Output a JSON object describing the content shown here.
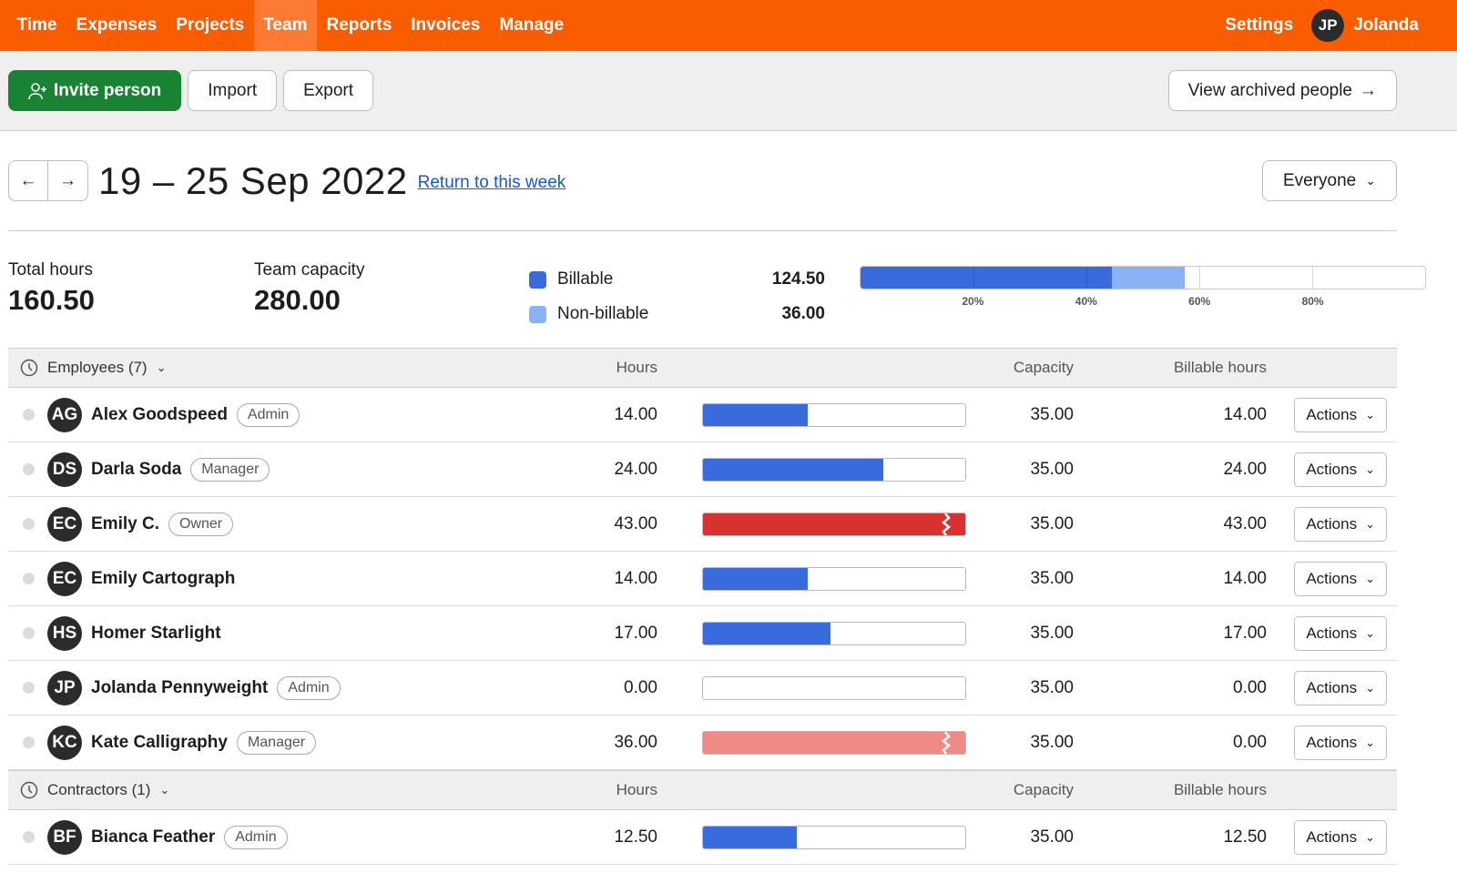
{
  "nav": {
    "items": [
      {
        "label": "Time",
        "active": false
      },
      {
        "label": "Expenses",
        "active": false
      },
      {
        "label": "Projects",
        "active": false
      },
      {
        "label": "Team",
        "active": true
      },
      {
        "label": "Reports",
        "active": false
      },
      {
        "label": "Invoices",
        "active": false
      },
      {
        "label": "Manage",
        "active": false
      }
    ],
    "settings": "Settings",
    "user_initials": "JP",
    "user_name": "Jolanda"
  },
  "toolbar": {
    "invite": "Invite person",
    "import": "Import",
    "export": "Export",
    "archived": "View archived people"
  },
  "week": {
    "title": "19 – 25 Sep 2022",
    "return_link": "Return to this week",
    "filter": "Everyone"
  },
  "summary": {
    "total_label": "Total hours",
    "total_value": "160.50",
    "capacity_label": "Team capacity",
    "capacity_value": "280.00",
    "billable_label": "Billable",
    "billable_value": "124.50",
    "nonbillable_label": "Non-billable",
    "nonbillable_value": "36.00",
    "billable_pct": 44.5,
    "nonbillable_pct": 12.9,
    "ticks": [
      "20%",
      "40%",
      "60%",
      "80%"
    ]
  },
  "colors": {
    "brand": "#fa5d00",
    "billable": "#3a6bdc",
    "nonbillable": "#8ab3f5",
    "over": "#d93030",
    "over_light": "#f08a84",
    "invite": "#188433"
  },
  "columns": {
    "hours": "Hours",
    "capacity": "Capacity",
    "billable": "Billable hours"
  },
  "actions_label": "Actions",
  "groups": [
    {
      "label": "Employees (7)",
      "people": [
        {
          "initials": "AG",
          "name": "Alex Goodspeed",
          "role": "Admin",
          "hours": "14.00",
          "capacity": "35.00",
          "billable": "14.00",
          "fill_pct": 40,
          "kind": "billable"
        },
        {
          "initials": "DS",
          "name": "Darla Soda",
          "role": "Manager",
          "hours": "24.00",
          "capacity": "35.00",
          "billable": "24.00",
          "fill_pct": 68.6,
          "kind": "billable"
        },
        {
          "initials": "EC",
          "name": "Emily C.",
          "role": "Owner",
          "hours": "43.00",
          "capacity": "35.00",
          "billable": "43.00",
          "fill_pct": 100,
          "kind": "over"
        },
        {
          "initials": "EC",
          "name": "Emily Cartograph",
          "role": "",
          "hours": "14.00",
          "capacity": "35.00",
          "billable": "14.00",
          "fill_pct": 40,
          "kind": "billable"
        },
        {
          "initials": "HS",
          "name": "Homer Starlight",
          "role": "",
          "hours": "17.00",
          "capacity": "35.00",
          "billable": "17.00",
          "fill_pct": 48.6,
          "kind": "billable"
        },
        {
          "initials": "JP",
          "name": "Jolanda Pennyweight",
          "role": "Admin",
          "hours": "0.00",
          "capacity": "35.00",
          "billable": "0.00",
          "fill_pct": 0,
          "kind": "billable"
        },
        {
          "initials": "KC",
          "name": "Kate Calligraphy",
          "role": "Manager",
          "hours": "36.00",
          "capacity": "35.00",
          "billable": "0.00",
          "fill_pct": 100,
          "kind": "over_light"
        }
      ]
    },
    {
      "label": "Contractors (1)",
      "people": [
        {
          "initials": "BF",
          "name": "Bianca Feather",
          "role": "Admin",
          "hours": "12.50",
          "capacity": "35.00",
          "billable": "12.50",
          "fill_pct": 35.7,
          "kind": "billable"
        }
      ]
    }
  ]
}
